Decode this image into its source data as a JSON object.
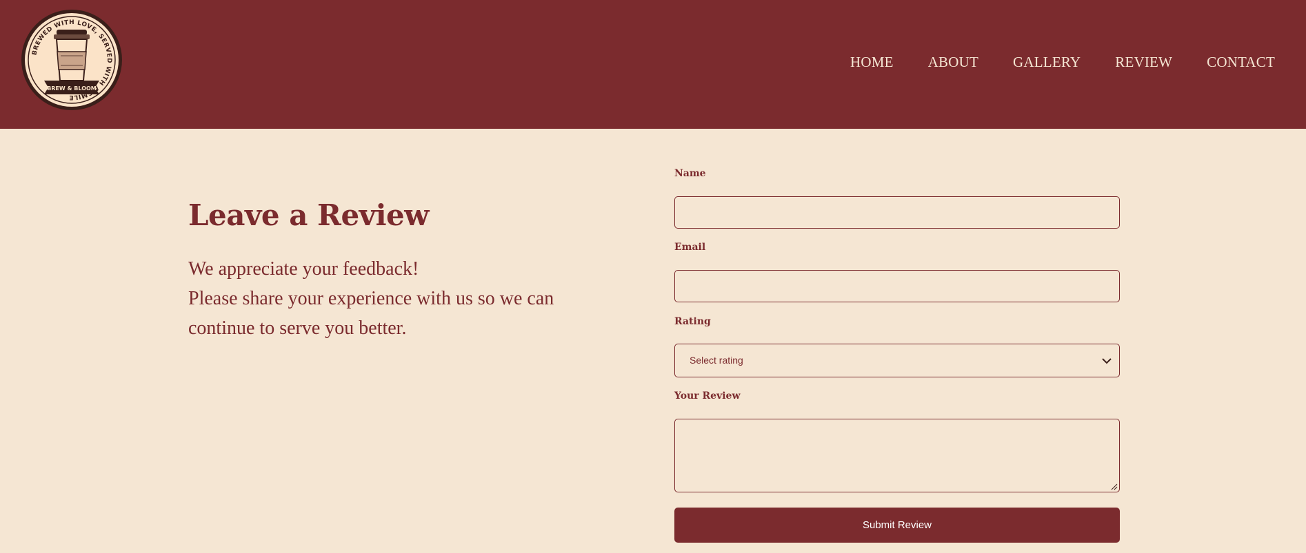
{
  "brand": {
    "logo_ring_text": "BREWED WITH LOVE, SERVED WITH A SMILE",
    "logo_banner_text": "BREW & BLOOM"
  },
  "nav": {
    "items": [
      "HOME",
      "ABOUT",
      "GALLERY",
      "REVIEW",
      "CONTACT"
    ]
  },
  "hero": {
    "title": "Leave a Review",
    "line1": "We appreciate your feedback!",
    "line2": "Please share your experience with us so we can",
    "line3": "continue to serve you better."
  },
  "form": {
    "name_label": "Name",
    "name_value": "",
    "email_label": "Email",
    "email_value": "",
    "rating_label": "Rating",
    "rating_selected": "Select rating",
    "review_label": "Your Review",
    "review_value": "",
    "submit_label": "Submit Review"
  },
  "colors": {
    "primary": "#7b2b2e",
    "background": "#f5e6d3",
    "button_text": "#ffffff"
  },
  "icons": {
    "select_arrow": "chevron-down-icon",
    "textarea_handle": "resize-handle-icon",
    "logo": "coffee-cup-icon"
  }
}
